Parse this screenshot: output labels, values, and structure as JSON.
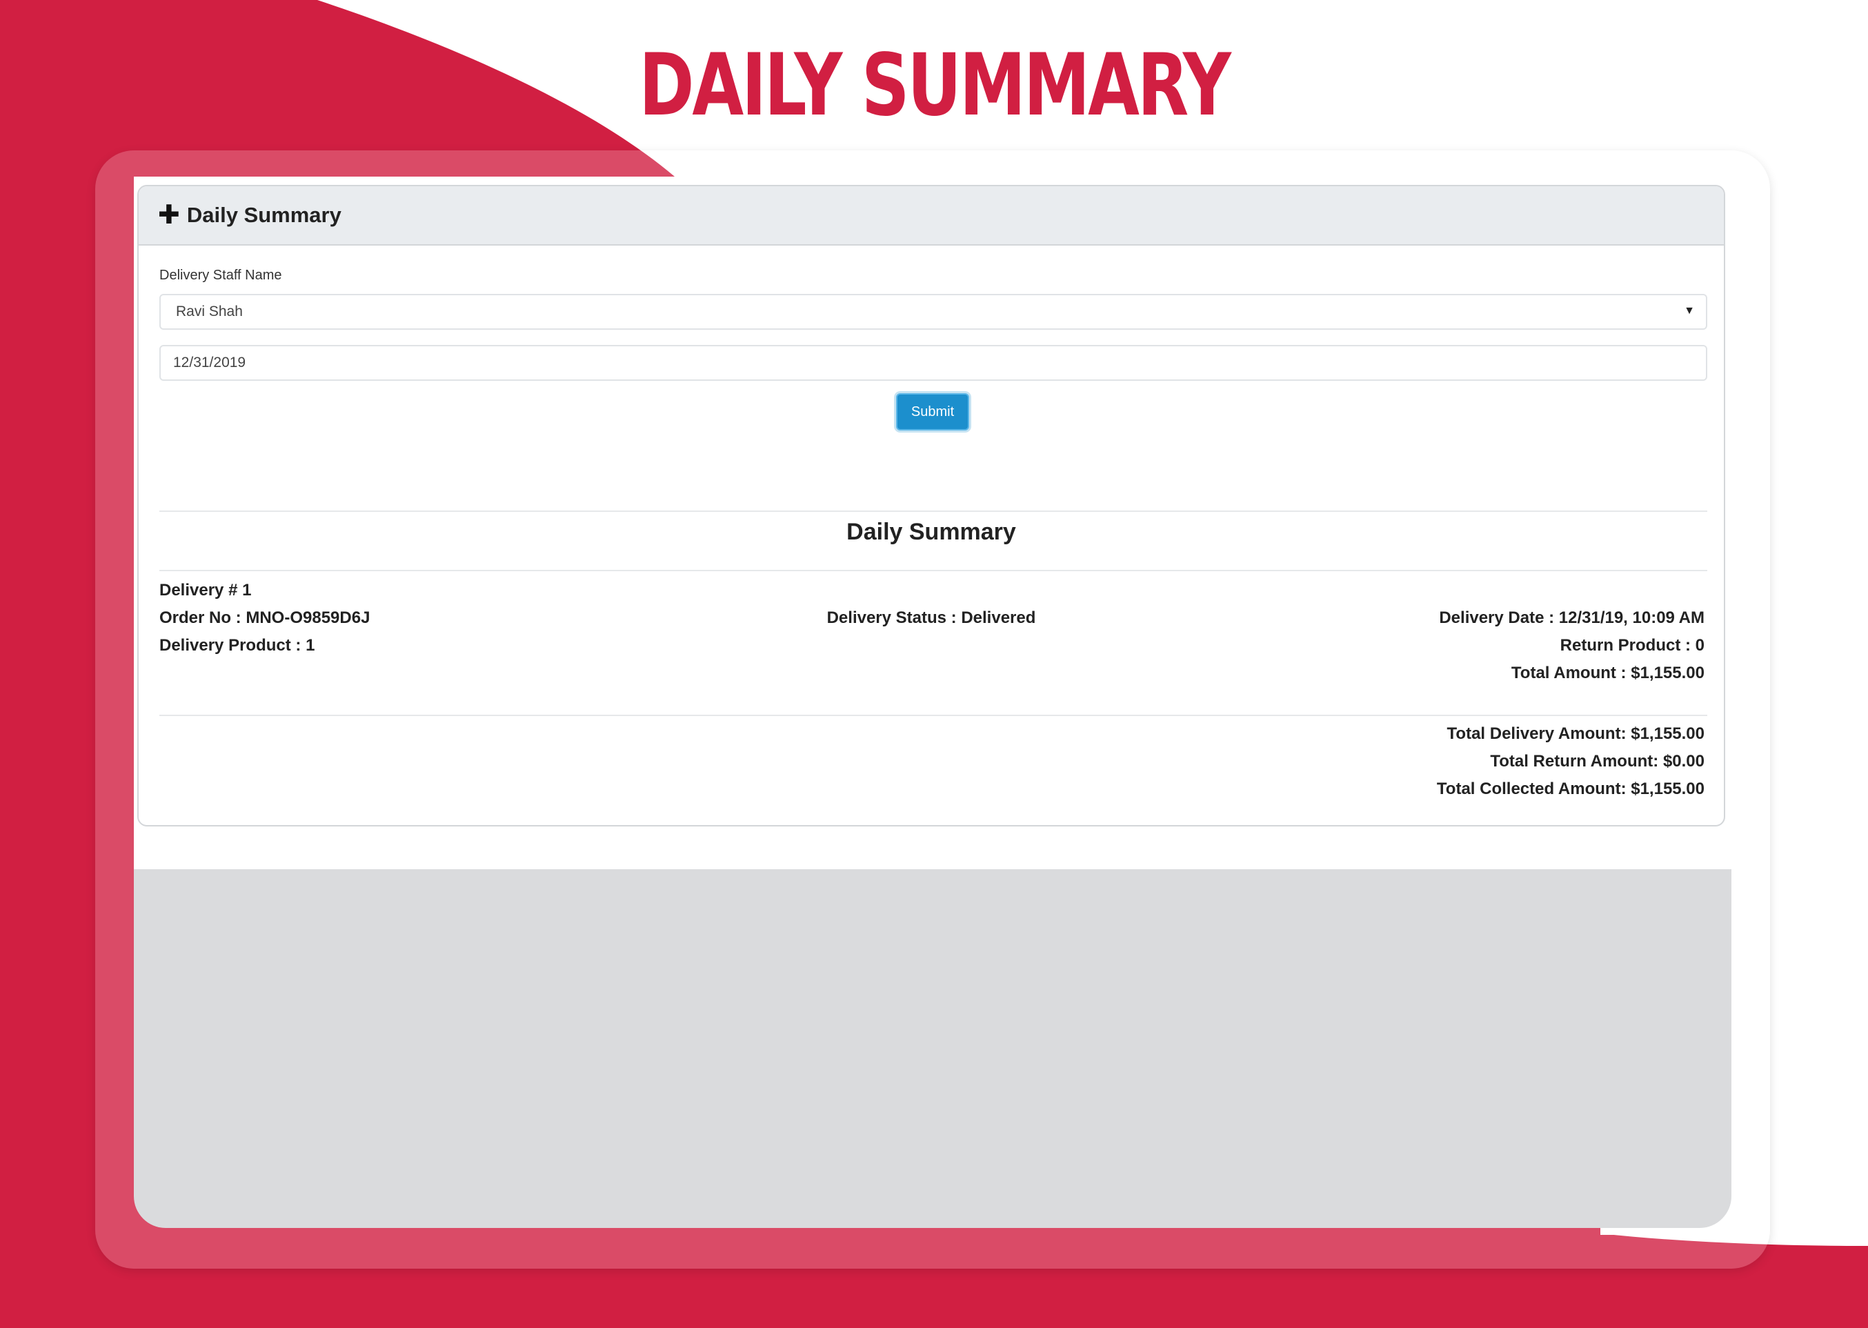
{
  "hero": {
    "title": "DAILY SUMMARY"
  },
  "card": {
    "header_icon": "plus-icon",
    "header_title": "Daily Summary",
    "form": {
      "staff_label": "Delivery Staff Name",
      "staff_selected": "Ravi Shah",
      "date_value": "12/31/2019",
      "submit_label": "Submit"
    },
    "summary": {
      "title": "Daily Summary",
      "delivery": {
        "number": "Delivery # 1",
        "order_no": "Order No : MNO-O9859D6J",
        "product": "Delivery Product : 1",
        "status": "Delivery Status : Delivered",
        "date": "Delivery Date : 12/31/19, 10:09 AM",
        "return_product": "Return Product : 0",
        "total_amount": "Total Amount : $1,155.00"
      },
      "totals": {
        "delivery": "Total Delivery Amount: $1,155.00",
        "return": "Total Return Amount: $0.00",
        "collected": "Total Collected Amount: $1,155.00"
      }
    }
  },
  "colors": {
    "brand_red": "#d11f42",
    "button_blue": "#1c8fcd",
    "header_gray": "#e9ecef",
    "screen_gray": "#dadbdd"
  }
}
